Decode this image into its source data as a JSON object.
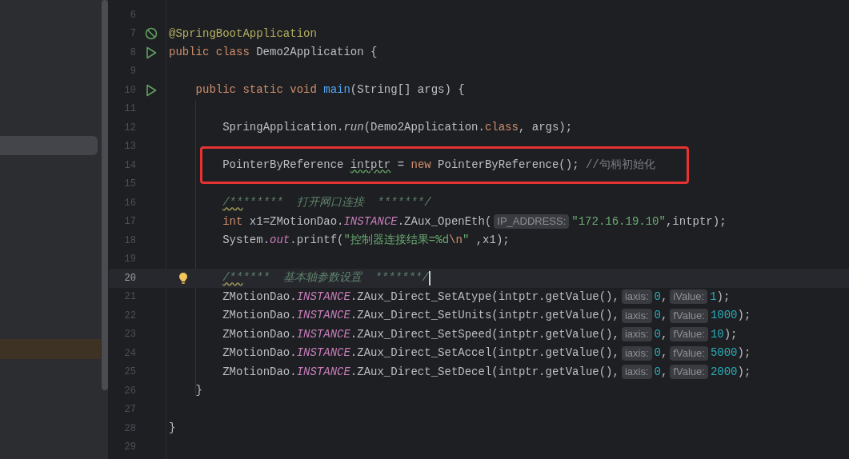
{
  "project_panel": {
    "rows": [
      {
        "kind": "selection"
      },
      {
        "kind": "search-match"
      }
    ]
  },
  "editor": {
    "lines": [
      {
        "number": "6",
        "current": false,
        "highlighted": false
      },
      {
        "number": "7",
        "current": false,
        "highlighted": false,
        "kind": "spring",
        "tokens": [
          {
            "kind": "annotation",
            "text": "@SpringBootApplication"
          }
        ]
      },
      {
        "number": "8",
        "current": false,
        "highlighted": false,
        "kind": "run",
        "tokens": [
          {
            "kind": "keyword",
            "text": "public class "
          },
          {
            "kind": "plain",
            "text": "Demo2Application {"
          }
        ]
      },
      {
        "number": "9",
        "current": false,
        "highlighted": false
      },
      {
        "number": "10",
        "current": false,
        "highlighted": false,
        "kind": "run",
        "tokens": [
          {
            "kind": "keyword",
            "text": "    public static void "
          },
          {
            "kind": "method",
            "text": "main"
          },
          {
            "kind": "plain",
            "text": "(String[] args) {"
          }
        ]
      },
      {
        "number": "11",
        "current": false,
        "highlighted": false
      },
      {
        "number": "12",
        "current": false,
        "highlighted": false,
        "tokens": [
          {
            "kind": "plain",
            "text": "        SpringApplication."
          },
          {
            "kind": "italic",
            "text": "run"
          },
          {
            "kind": "plain",
            "text": "(Demo2Application."
          },
          {
            "kind": "keyword",
            "text": "class"
          },
          {
            "kind": "plain",
            "text": ", args);"
          }
        ]
      },
      {
        "number": "13",
        "current": false,
        "highlighted": false
      },
      {
        "number": "14",
        "current": false,
        "highlighted": true,
        "tokens": [
          {
            "kind": "plain",
            "text": "        PointerByReference "
          },
          {
            "kind": "typo",
            "text": "intptr"
          },
          {
            "kind": "plain",
            "text": " = "
          },
          {
            "kind": "keyword",
            "text": "new"
          },
          {
            "kind": "plain",
            "text": " PointerByReference(); "
          },
          {
            "kind": "comment",
            "text": "//句柄初始化"
          }
        ]
      },
      {
        "number": "15",
        "current": false,
        "highlighted": false
      },
      {
        "number": "16",
        "current": false,
        "highlighted": false,
        "tokens": [
          {
            "kind": "block-comment-typo",
            "text": "        /**"
          },
          {
            "kind": "block-comment",
            "text": "******  打开网口连接  *******/"
          }
        ]
      },
      {
        "number": "17",
        "current": false,
        "highlighted": false,
        "tokens": [
          {
            "kind": "keyword",
            "text": "        int"
          },
          {
            "kind": "plain",
            "text": " x1=ZMotionDao."
          },
          {
            "kind": "static",
            "text": "INSTANCE"
          },
          {
            "kind": "plain",
            "text": ".ZAux_OpenEth("
          },
          {
            "kind": "hint",
            "text": "IP_ADDRESS:"
          },
          {
            "kind": "string",
            "text": "\"172.16.19.10\""
          },
          {
            "kind": "plain",
            "text": ",intptr);"
          }
        ]
      },
      {
        "number": "18",
        "current": false,
        "highlighted": false,
        "tokens": [
          {
            "kind": "plain",
            "text": "        System."
          },
          {
            "kind": "static",
            "text": "out"
          },
          {
            "kind": "plain",
            "text": ".printf("
          },
          {
            "kind": "string",
            "text": "\"控制器连接结果=%d"
          },
          {
            "kind": "escape",
            "text": "\\n"
          },
          {
            "kind": "string",
            "text": "\""
          },
          {
            "kind": "plain",
            "text": " ,x1);"
          }
        ]
      },
      {
        "number": "19",
        "current": false,
        "highlighted": false
      },
      {
        "number": "20",
        "current": true,
        "highlighted": false,
        "kind": "bulb",
        "tokens": [
          {
            "kind": "block-comment-typo",
            "text": "        /**"
          },
          {
            "kind": "block-comment",
            "text": "****  基本轴参数设置  *******/"
          }
        ]
      },
      {
        "number": "21",
        "current": false,
        "highlighted": false,
        "tokens": [
          {
            "kind": "plain",
            "text": "        ZMotionDao."
          },
          {
            "kind": "static",
            "text": "INSTANCE"
          },
          {
            "kind": "plain",
            "text": ".ZAux_Direct_SetAtype(intptr.getValue(),"
          },
          {
            "kind": "hint",
            "text": "iaxis:"
          },
          {
            "kind": "number",
            "text": "0"
          },
          {
            "kind": "plain",
            "text": ","
          },
          {
            "kind": "hint",
            "text": "iValue:"
          },
          {
            "kind": "number",
            "text": "1"
          },
          {
            "kind": "plain",
            "text": ");"
          }
        ]
      },
      {
        "number": "22",
        "current": false,
        "highlighted": false,
        "tokens": [
          {
            "kind": "plain",
            "text": "        ZMotionDao."
          },
          {
            "kind": "static",
            "text": "INSTANCE"
          },
          {
            "kind": "plain",
            "text": ".ZAux_Direct_SetUnits(intptr.getValue(),"
          },
          {
            "kind": "hint",
            "text": "iaxis:"
          },
          {
            "kind": "number",
            "text": "0"
          },
          {
            "kind": "plain",
            "text": ","
          },
          {
            "kind": "hint",
            "text": "fValue:"
          },
          {
            "kind": "number",
            "text": "1000"
          },
          {
            "kind": "plain",
            "text": ");"
          }
        ]
      },
      {
        "number": "23",
        "current": false,
        "highlighted": false,
        "tokens": [
          {
            "kind": "plain",
            "text": "        ZMotionDao."
          },
          {
            "kind": "static",
            "text": "INSTANCE"
          },
          {
            "kind": "plain",
            "text": ".ZAux_Direct_SetSpeed(intptr.getValue(),"
          },
          {
            "kind": "hint",
            "text": "iaxis:"
          },
          {
            "kind": "number",
            "text": "0"
          },
          {
            "kind": "plain",
            "text": ","
          },
          {
            "kind": "hint",
            "text": "fValue:"
          },
          {
            "kind": "number",
            "text": "10"
          },
          {
            "kind": "plain",
            "text": ");"
          }
        ]
      },
      {
        "number": "24",
        "current": false,
        "highlighted": false,
        "tokens": [
          {
            "kind": "plain",
            "text": "        ZMotionDao."
          },
          {
            "kind": "static",
            "text": "INSTANCE"
          },
          {
            "kind": "plain",
            "text": ".ZAux_Direct_SetAccel(intptr.getValue(),"
          },
          {
            "kind": "hint",
            "text": "iaxis:"
          },
          {
            "kind": "number",
            "text": "0"
          },
          {
            "kind": "plain",
            "text": ","
          },
          {
            "kind": "hint",
            "text": "fValue:"
          },
          {
            "kind": "number",
            "text": "5000"
          },
          {
            "kind": "plain",
            "text": ");"
          }
        ]
      },
      {
        "number": "25",
        "current": false,
        "highlighted": false,
        "tokens": [
          {
            "kind": "plain",
            "text": "        ZMotionDao."
          },
          {
            "kind": "static",
            "text": "INSTANCE"
          },
          {
            "kind": "plain",
            "text": ".ZAux_Direct_SetDecel(intptr.getValue(),"
          },
          {
            "kind": "hint",
            "text": "iaxis:"
          },
          {
            "kind": "number",
            "text": "0"
          },
          {
            "kind": "plain",
            "text": ","
          },
          {
            "kind": "hint",
            "text": "fValue:"
          },
          {
            "kind": "number",
            "text": "2000"
          },
          {
            "kind": "plain",
            "text": ");"
          }
        ]
      },
      {
        "number": "26",
        "current": false,
        "highlighted": false,
        "tokens": [
          {
            "kind": "plain",
            "text": "    }"
          }
        ]
      },
      {
        "number": "27",
        "current": false,
        "highlighted": false
      },
      {
        "number": "28",
        "current": false,
        "highlighted": false,
        "tokens": [
          {
            "kind": "plain",
            "text": "}"
          }
        ]
      },
      {
        "number": "29",
        "current": false,
        "highlighted": false
      }
    ]
  }
}
